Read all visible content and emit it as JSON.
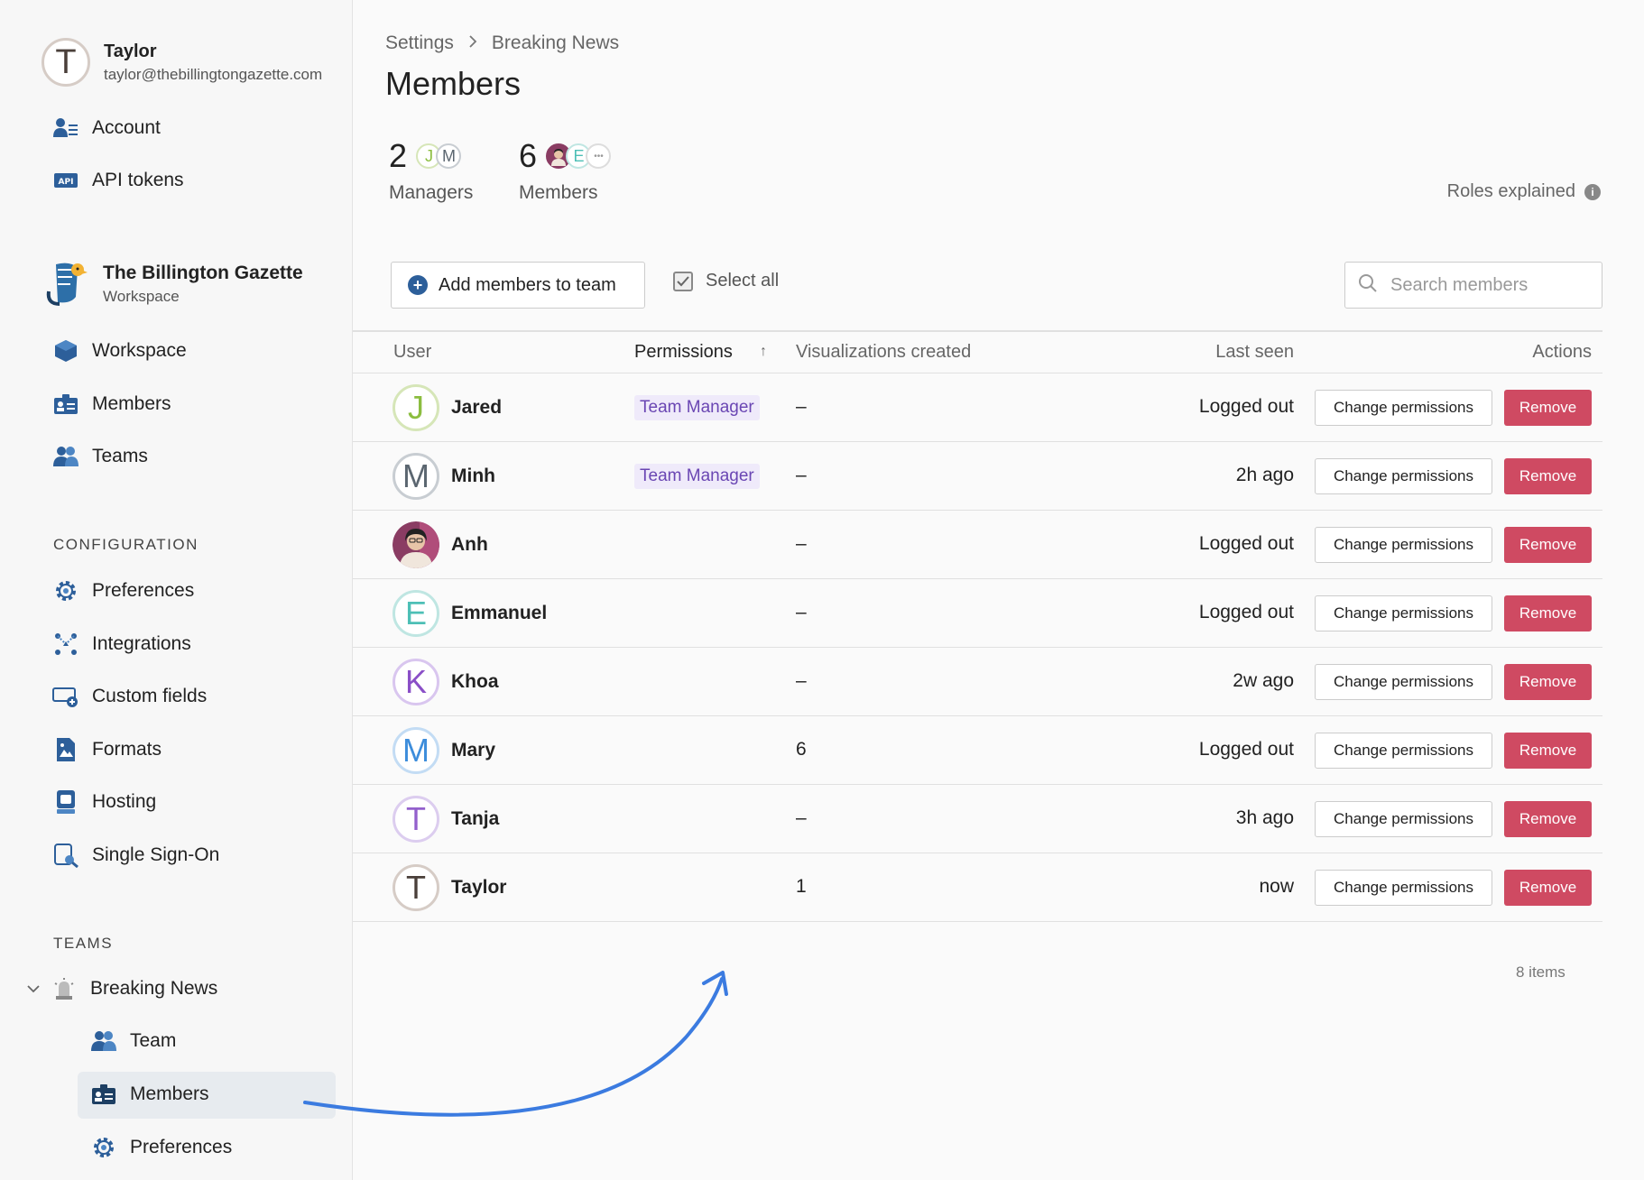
{
  "user": {
    "initial": "T",
    "name": "Taylor",
    "email": "taylor@thebillingtongazette.com"
  },
  "account_nav": [
    {
      "label": "Account",
      "icon": "account-icon"
    },
    {
      "label": "API tokens",
      "icon": "api-icon"
    }
  ],
  "workspace": {
    "name": "The Billington Gazette",
    "subtitle": "Workspace"
  },
  "workspace_nav": [
    {
      "label": "Workspace",
      "icon": "cube-icon"
    },
    {
      "label": "Members",
      "icon": "id-card-icon"
    },
    {
      "label": "Teams",
      "icon": "people-icon"
    }
  ],
  "configuration": {
    "heading": "CONFIGURATION",
    "items": [
      {
        "label": "Preferences",
        "icon": "gear-icon"
      },
      {
        "label": "Integrations",
        "icon": "nodes-icon"
      },
      {
        "label": "Custom fields",
        "icon": "field-plus-icon"
      },
      {
        "label": "Formats",
        "icon": "image-file-icon"
      },
      {
        "label": "Hosting",
        "icon": "server-icon"
      },
      {
        "label": "Single Sign-On",
        "icon": "key-icon"
      }
    ]
  },
  "teams": {
    "heading": "TEAMS",
    "team_name": "Breaking News",
    "items": [
      {
        "label": "Team",
        "icon": "people-icon"
      },
      {
        "label": "Members",
        "icon": "id-card-icon",
        "active": true
      },
      {
        "label": "Preferences",
        "icon": "gear-icon"
      }
    ]
  },
  "breadcrumb": {
    "parent": "Settings",
    "current": "Breaking News"
  },
  "title": "Members",
  "stats": {
    "managers": {
      "count": "2",
      "label": "Managers",
      "avatars": [
        "J",
        "M"
      ]
    },
    "members": {
      "count": "6",
      "label": "Members",
      "avatars": [
        "photo",
        "E",
        "•••"
      ]
    }
  },
  "roles_explained": "Roles explained",
  "toolbar": {
    "add_label": "Add members to team",
    "select_all": "Select all",
    "search_placeholder": "Search members"
  },
  "table": {
    "headers": {
      "user": "User",
      "permissions": "Permissions",
      "sort_indicator": "↑",
      "visualizations": "Visualizations created",
      "last_seen": "Last seen",
      "actions": "Actions"
    },
    "change_label": "Change permissions",
    "remove_label": "Remove",
    "rows": [
      {
        "initial": "J",
        "name": "Jared",
        "permission": "Team Manager",
        "viz": "–",
        "seen": "Logged out",
        "color": "#8bbd3f",
        "border": "#d6e6b8"
      },
      {
        "initial": "M",
        "name": "Minh",
        "permission": "Team Manager",
        "viz": "–",
        "seen": "2h ago",
        "color": "#5b6670",
        "border": "#c8cdd2"
      },
      {
        "initial": "",
        "name": "Anh",
        "permission": "",
        "viz": "–",
        "seen": "Logged out",
        "color": "#8a3c63",
        "border": "#8a3c63",
        "photo": true
      },
      {
        "initial": "E",
        "name": "Emmanuel",
        "permission": "",
        "viz": "–",
        "seen": "Logged out",
        "color": "#4dbfb6",
        "border": "#bfe6e2"
      },
      {
        "initial": "K",
        "name": "Khoa",
        "permission": "",
        "viz": "–",
        "seen": "2w ago",
        "color": "#8a4fc7",
        "border": "#d9c6ef"
      },
      {
        "initial": "M",
        "name": "Mary",
        "permission": "",
        "viz": "6",
        "seen": "Logged out",
        "color": "#3d8ddb",
        "border": "#c3dcf4"
      },
      {
        "initial": "T",
        "name": "Tanja",
        "permission": "",
        "viz": "–",
        "seen": "3h ago",
        "color": "#9360cc",
        "border": "#dccdef"
      },
      {
        "initial": "T",
        "name": "Taylor",
        "permission": "",
        "viz": "1",
        "seen": "now",
        "color": "#4a3f3a",
        "border": "#d6ccc6"
      }
    ]
  },
  "items_count": "8 items",
  "colors": {
    "accent": "#2d5f9a",
    "remove": "#cf4a62",
    "badge_text": "#6a46b3",
    "badge_bg": "#efeafa",
    "arrow": "#3b7be0"
  }
}
